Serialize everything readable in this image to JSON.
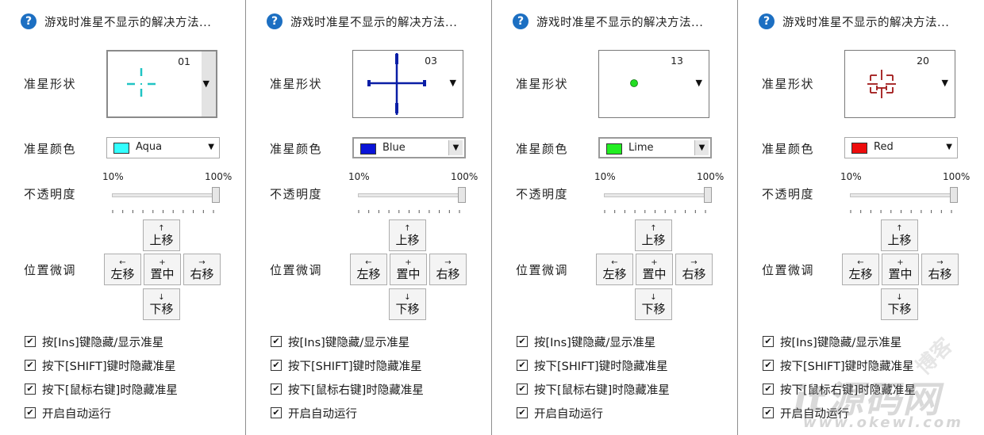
{
  "title": "游戏时准星不显示的解决方法...",
  "labels": {
    "shape": "准星形状",
    "color": "准星颜色",
    "opacity": "不透明度",
    "position": "位置微调"
  },
  "opacity": {
    "min_label": "10%",
    "max_label": "100%",
    "value_percent": 100
  },
  "nudge_buttons": {
    "up": {
      "symbol": "↑",
      "label": "上移"
    },
    "left": {
      "symbol": "←",
      "label": "左移"
    },
    "center": {
      "symbol": "+",
      "label": "置中"
    },
    "right": {
      "symbol": "→",
      "label": "右移"
    },
    "down": {
      "symbol": "↓",
      "label": "下移"
    }
  },
  "checkboxes": [
    {
      "label": "按[Ins]键隐藏/显示准星",
      "checked": true
    },
    {
      "label": "按下[SHIFT]键时隐藏准星",
      "checked": true
    },
    {
      "label": "按下[鼠标右键]时隐藏准星",
      "checked": true
    },
    {
      "label": "开启自动运行",
      "checked": true
    }
  ],
  "panels": [
    {
      "shape_number": "01",
      "color_name": "Aqua",
      "color_hex": "#33ffff",
      "shape_style": "dashed-cross",
      "shape_color": "#20c4c4"
    },
    {
      "shape_number": "03",
      "color_name": "Blue",
      "color_hex": "#0a14d8",
      "shape_style": "bold-cross",
      "shape_color": "#0a1ea6"
    },
    {
      "shape_number": "13",
      "color_name": "Lime",
      "color_hex": "#22ee22",
      "shape_style": "dot",
      "shape_color": "#22dd22"
    },
    {
      "shape_number": "20",
      "color_name": "Red",
      "color_hex": "#ee0c0c",
      "shape_style": "bracket-cross",
      "shape_color": "#a01818"
    }
  ],
  "watermark": {
    "text": "it源码网",
    "url": "www.okewl.com",
    "blog": "博客"
  },
  "icons": {
    "help": "?",
    "dropdown": "▼",
    "check": "✔"
  }
}
